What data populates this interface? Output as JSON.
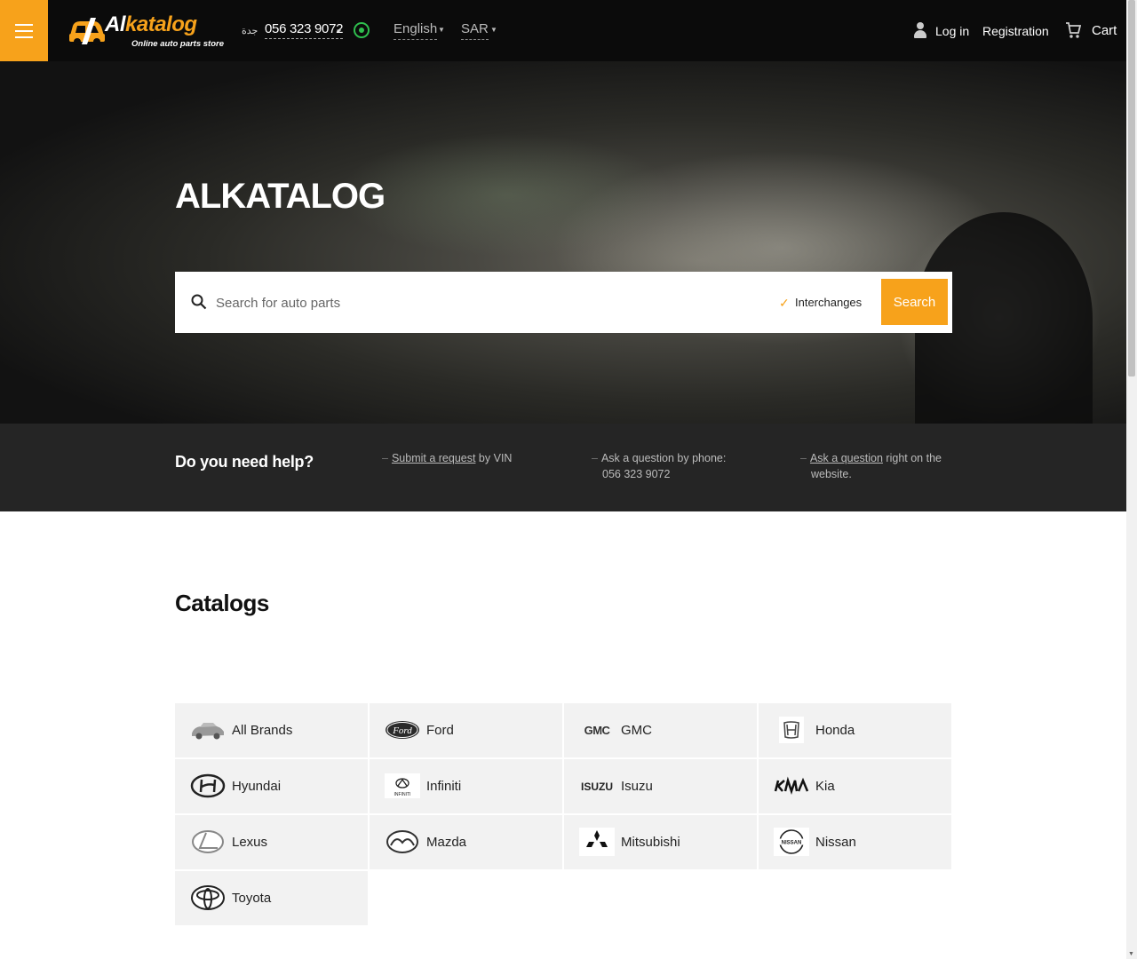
{
  "header": {
    "logo": {
      "brand_part1": "Al",
      "brand_part2": "katalog",
      "tagline": "Online auto parts store"
    },
    "city": "جدة",
    "phone": "056 323 9072",
    "language": "English",
    "currency": "SAR",
    "login": "Log in",
    "registration": "Registration",
    "cart": "Cart"
  },
  "hero": {
    "title": "ALKATALOG",
    "search": {
      "placeholder": "Search for auto parts",
      "value": "",
      "interchanges_label": "Interchanges",
      "interchanges_checked": true,
      "button": "Search"
    }
  },
  "help": {
    "title": "Do you need help?",
    "items": [
      {
        "link": "Submit a request",
        "text": " by VIN",
        "line2": ""
      },
      {
        "link": "",
        "text": "Ask a question by phone:",
        "line2": "056 323 9072"
      },
      {
        "link": "Ask a question",
        "text": " right on the",
        "line2": "website."
      }
    ]
  },
  "catalogs": {
    "title": "Catalogs",
    "brands": [
      {
        "name": "All Brands",
        "icon": "car-icon"
      },
      {
        "name": "Ford",
        "icon": "ford-logo"
      },
      {
        "name": "GMC",
        "icon": "gmc-logo"
      },
      {
        "name": "Honda",
        "icon": "honda-logo"
      },
      {
        "name": "Hyundai",
        "icon": "hyundai-logo"
      },
      {
        "name": "Infiniti",
        "icon": "infiniti-logo"
      },
      {
        "name": "Isuzu",
        "icon": "isuzu-logo"
      },
      {
        "name": "Kia",
        "icon": "kia-logo"
      },
      {
        "name": "Lexus",
        "icon": "lexus-logo"
      },
      {
        "name": "Mazda",
        "icon": "mazda-logo"
      },
      {
        "name": "Mitsubishi",
        "icon": "mitsubishi-logo"
      },
      {
        "name": "Nissan",
        "icon": "nissan-logo"
      },
      {
        "name": "Toyota",
        "icon": "toyota-logo"
      }
    ]
  },
  "colors": {
    "accent": "#f7a21b",
    "header_bg": "#0b0b0b",
    "help_bg": "#252525",
    "whatsapp": "#2fbf4e"
  }
}
